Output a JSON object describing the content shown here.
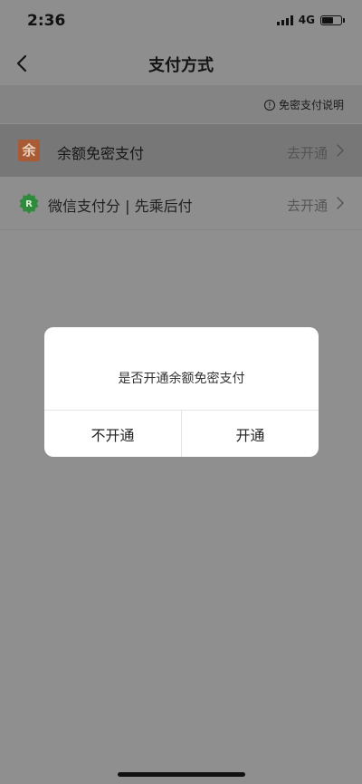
{
  "status_bar": {
    "time": "2:36",
    "network": "4G"
  },
  "nav": {
    "title": "支付方式",
    "back_icon": "chevron-left-icon"
  },
  "info": {
    "text": "免密支付说明",
    "icon": "info-circle-icon"
  },
  "payment_methods": [
    {
      "icon_glyph": "余",
      "label": "余额免密支付",
      "action": "去开通"
    },
    {
      "icon": "wechat-pay-score-icon",
      "label": "微信支付分 | 先乘后付",
      "action": "去开通"
    }
  ],
  "dialog": {
    "message": "是否开通余额免密支付",
    "cancel_label": "不开通",
    "confirm_label": "开通"
  },
  "colors": {
    "wechat_green": "#2f8a3c",
    "balance_orange": "#a85b35",
    "dialog_bg": "#ffffff"
  }
}
